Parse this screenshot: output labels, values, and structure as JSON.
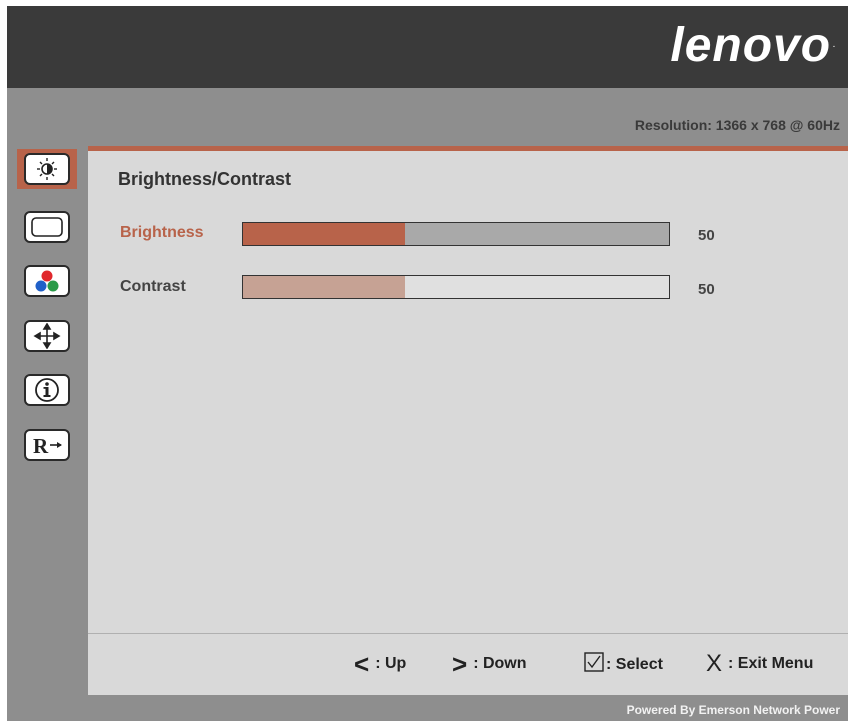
{
  "header": {
    "logo_text": "lenovo",
    "logo_mark": "."
  },
  "status": {
    "resolution": "Resolution: 1366 x 768 @ 60Hz"
  },
  "sidebar": {
    "items": [
      {
        "name": "brightness-contrast",
        "icon": "sun-icon",
        "active": true
      },
      {
        "name": "image-properties",
        "icon": "screen-frame-icon",
        "active": false
      },
      {
        "name": "color",
        "icon": "color-dots-icon",
        "active": false
      },
      {
        "name": "position",
        "icon": "move-arrows-icon",
        "active": false
      },
      {
        "name": "information",
        "icon": "info-icon",
        "active": false
      },
      {
        "name": "reset",
        "icon": "reset-icon",
        "active": false
      }
    ]
  },
  "main": {
    "title": "Brightness/Contrast",
    "rows": [
      {
        "label": "Brightness",
        "value": "50",
        "level": 0.38,
        "selected": true
      },
      {
        "label": "Contrast",
        "value": "50",
        "level": 0.38,
        "selected": false
      }
    ]
  },
  "footer": {
    "up_glyph": "<",
    "up_label": ": Up",
    "down_glyph": ">",
    "down_label": ": Down",
    "select_label": ": Select",
    "exit_glyph": "X",
    "exit_label": ": Exit Menu"
  },
  "credit": "Powered By Emerson Network Power",
  "colors": {
    "accent": "#b8634a",
    "panel": "#d9d9d9",
    "frame": "#8e8e8e",
    "header": "#3a3a3a",
    "slider_track_brightness": "#a9a9a9",
    "slider_track_contrast": "#e0e0e0",
    "slider_fill_contrast": "#c6a294"
  }
}
